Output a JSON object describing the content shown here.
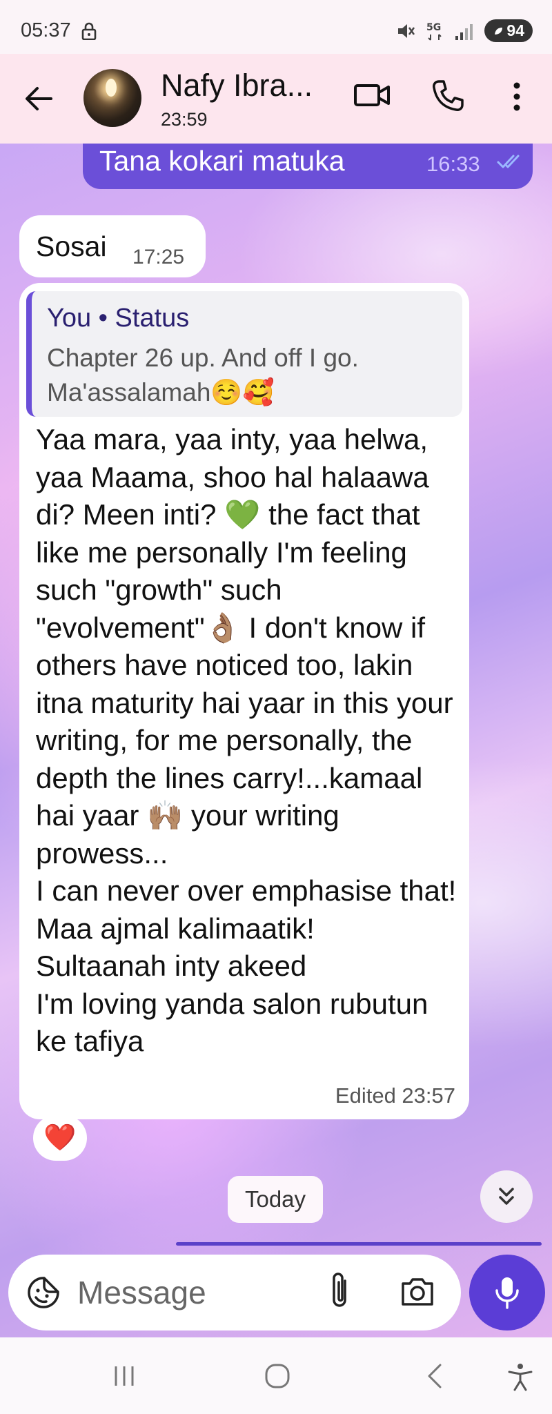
{
  "status_bar": {
    "time": "05:37",
    "battery": "94",
    "icons": [
      "lock-icon",
      "mute-icon",
      "5g-icon",
      "signal-icon",
      "battery-icon"
    ]
  },
  "header": {
    "contact_name": "Nafy Ibra...",
    "last_seen": "23:59",
    "icons": [
      "back-arrow-icon",
      "video-call-icon",
      "voice-call-icon",
      "more-vert-icon"
    ]
  },
  "messages": {
    "outgoing": {
      "text": "Tana kokari matuka",
      "time": "16:33",
      "status": "read"
    },
    "incoming_short": {
      "text": "Sosai",
      "time": "17:25"
    },
    "incoming_reply": {
      "quote_title": "You • Status",
      "quote_text": "Chapter 26 up. And off I go. Ma'assalamah☺️🥰",
      "body": "Yaa mara, yaa inty, yaa helwa, yaa Maama, shoo hal halaawa di? Meen inti? 💚 the fact that like me personally I'm feeling such \"growth\" such \"evolvement\"👌🏽 I don't know if others have noticed too, lakin itna maturity hai yaar in this your writing, for me personally, the depth the lines carry!...kamaal hai yaar 🙌🏽 your writing prowess...\nI can never over emphasise that! Maa ajmal kalimaatik!\nSultaanah inty akeed\nI'm loving yanda salon rubutun ke tafiya",
      "edited_label": "Edited 23:57",
      "reaction": "❤️"
    }
  },
  "date_chip": "Today",
  "composer": {
    "placeholder": "Message"
  },
  "colors": {
    "accent": "#6b4fd8",
    "mic": "#5b3dd6",
    "header_bg": "#fde6ee"
  },
  "nav_bar": [
    "recents-icon",
    "home-icon",
    "back-icon",
    "accessibility-icon"
  ]
}
